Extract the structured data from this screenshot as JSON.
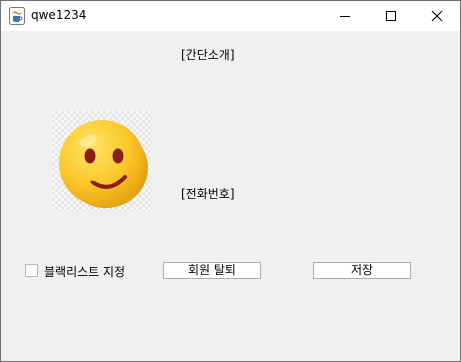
{
  "window": {
    "title": "qwe1234"
  },
  "profile": {
    "intro_label": "[간단소개]",
    "phone_label": "[전화번호]",
    "image": "smiley-face-icon"
  },
  "controls": {
    "blacklist_label": "블랙리스트 지정",
    "blacklist_checked": false,
    "withdraw_button": "회원 탈퇴",
    "save_button": "저장"
  }
}
